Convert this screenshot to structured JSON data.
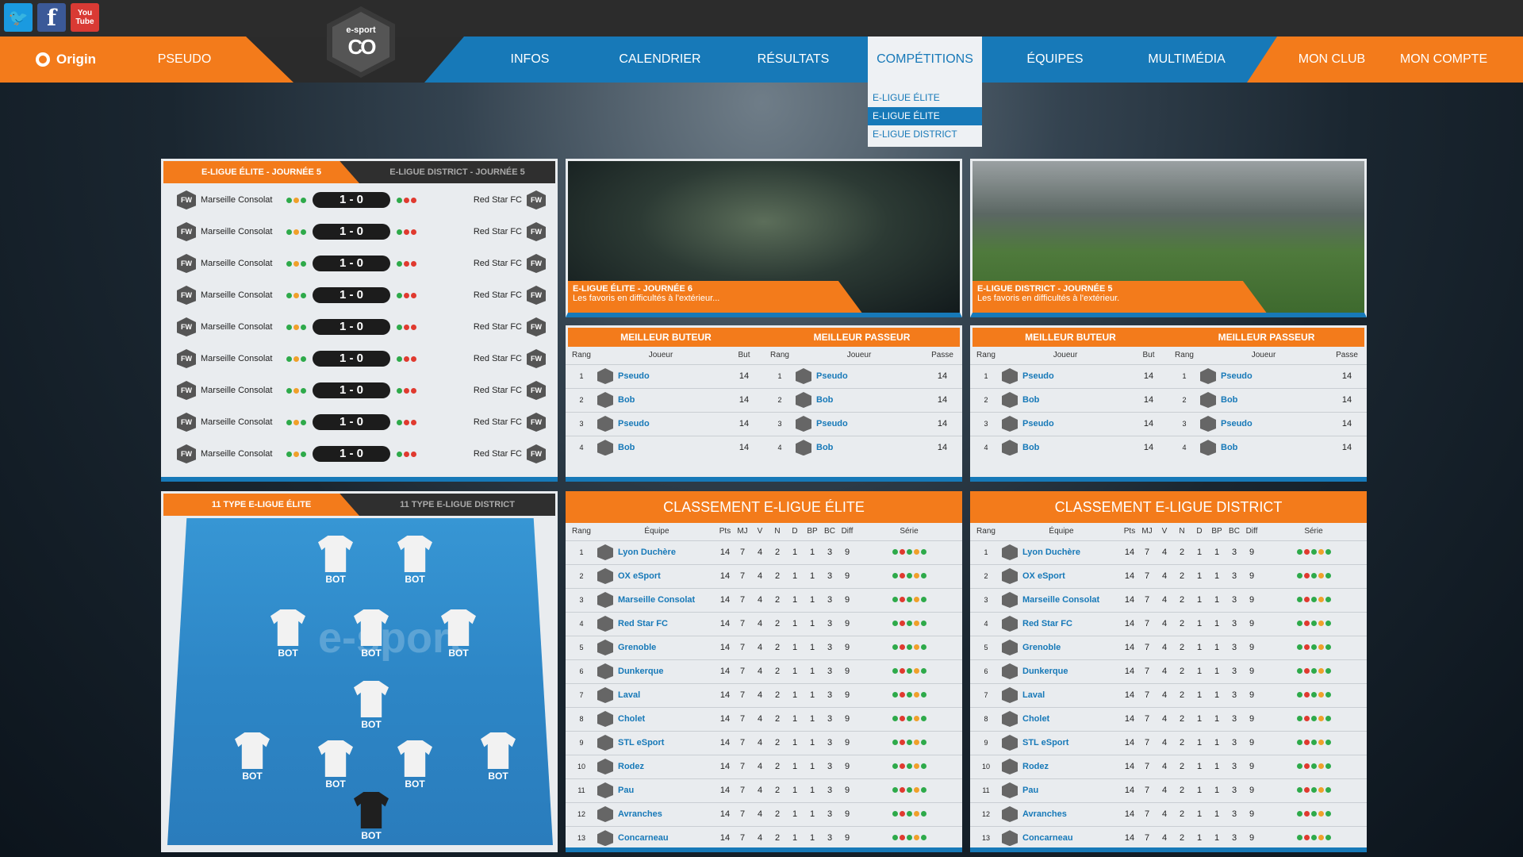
{
  "social": {
    "twitter": "twitter-icon",
    "facebook": "f",
    "youtube": "You Tube"
  },
  "nav": {
    "brand": "Origin",
    "pseudo": "PSEUDO",
    "logo_line1": "e-sport",
    "logo_line2": "CO",
    "items": [
      "INFOS",
      "CALENDRIER",
      "RÉSULTATS",
      "COMPÉTITIONS",
      "ÉQUIPES",
      "MULTIMÉDIA"
    ],
    "mon_club": "MON CLUB",
    "mon_compte": "MON COMPTE",
    "dropdown": [
      "E-LIGUE ÉLITE",
      "E-LIGUE ÉLITE",
      "E-LIGUE DISTRICT"
    ]
  },
  "results": {
    "tab_on": "E-LIGUE ÉLITE - JOURNÉE 5",
    "tab_off": "E-LIGUE DISTRICT - JOURNÉE 5",
    "matches": [
      {
        "home": "Marseille Consolat",
        "score": "1 - 0",
        "away": "Red Star FC"
      },
      {
        "home": "Marseille Consolat",
        "score": "1 - 0",
        "away": "Red Star FC"
      },
      {
        "home": "Marseille Consolat",
        "score": "1 - 0",
        "away": "Red Star FC"
      },
      {
        "home": "Marseille Consolat",
        "score": "1 - 0",
        "away": "Red Star FC"
      },
      {
        "home": "Marseille Consolat",
        "score": "1 - 0",
        "away": "Red Star FC"
      },
      {
        "home": "Marseille Consolat",
        "score": "1 - 0",
        "away": "Red Star FC"
      },
      {
        "home": "Marseille Consolat",
        "score": "1 - 0",
        "away": "Red Star FC"
      },
      {
        "home": "Marseille Consolat",
        "score": "1 - 0",
        "away": "Red Star FC"
      },
      {
        "home": "Marseille Consolat",
        "score": "1 - 0",
        "away": "Red Star FC"
      }
    ],
    "crest_text": "FW"
  },
  "news": [
    {
      "title": "E-LIGUE ÉLITE - JOURNÉE 6",
      "sub": "Les favoris en difficultés à l'extérieur..."
    },
    {
      "title": "E-LIGUE DISTRICT - JOURNÉE 5",
      "sub": "Les favoris en difficultés à l'extérieur."
    }
  ],
  "scorers": {
    "buteur": "MEILLEUR BUTEUR",
    "passeur": "MEILLEUR PASSEUR",
    "h_rang": "Rang",
    "h_joueur": "Joueur",
    "h_but": "But",
    "h_passe": "Passe",
    "rows": [
      {
        "rang": "1",
        "joueur": "Pseudo",
        "val": "14"
      },
      {
        "rang": "2",
        "joueur": "Bob",
        "val": "14"
      },
      {
        "rang": "3",
        "joueur": "Pseudo",
        "val": "14"
      },
      {
        "rang": "4",
        "joueur": "Bob",
        "val": "14"
      }
    ]
  },
  "lineup": {
    "tab_on": "11 TYPE E-LIGUE ÉLITE",
    "tab_off": "11 TYPE E-LIGUE DISTRICT",
    "label": "BOT",
    "watermark": "e-sport"
  },
  "standings": {
    "title_elite": "CLASSEMENT E-LIGUE ÉLITE",
    "title_district": "CLASSEMENT E-LIGUE DISTRICT",
    "headers": [
      "Rang",
      "Équipe",
      "Pts",
      "MJ",
      "V",
      "N",
      "D",
      "BP",
      "BC",
      "Diff",
      "Série"
    ],
    "rows": [
      {
        "rang": "1",
        "team": "Lyon Duchère"
      },
      {
        "rang": "2",
        "team": "OX eSport"
      },
      {
        "rang": "3",
        "team": "Marseille Consolat"
      },
      {
        "rang": "4",
        "team": "Red Star FC"
      },
      {
        "rang": "5",
        "team": "Grenoble"
      },
      {
        "rang": "6",
        "team": "Dunkerque"
      },
      {
        "rang": "7",
        "team": "Laval"
      },
      {
        "rang": "8",
        "team": "Cholet"
      },
      {
        "rang": "9",
        "team": "STL eSport"
      },
      {
        "rang": "10",
        "team": "Rodez"
      },
      {
        "rang": "11",
        "team": "Pau"
      },
      {
        "rang": "12",
        "team": "Avranches"
      },
      {
        "rang": "13",
        "team": "Concarneau"
      }
    ],
    "stats": [
      "14",
      "7",
      "4",
      "2",
      "1",
      "1",
      "3",
      "9"
    ]
  },
  "colors": {
    "orange": "#f37b1b",
    "blue": "#1779b8",
    "dark": "#2b2b2b"
  }
}
